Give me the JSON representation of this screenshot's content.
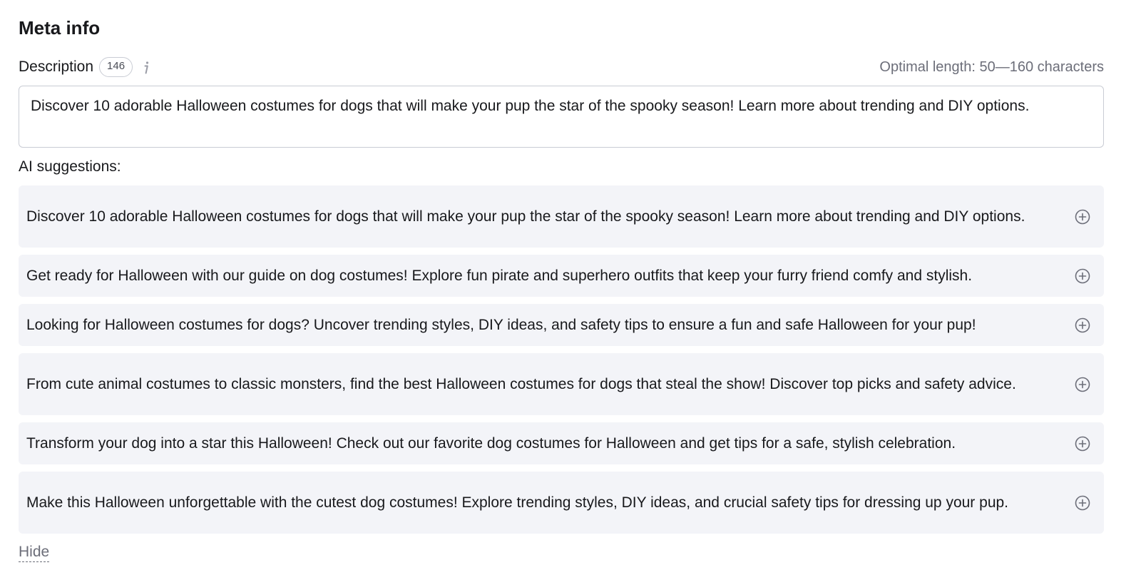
{
  "title": "Meta info",
  "description": {
    "label": "Description",
    "count": "146",
    "optimal_hint": "Optimal length: 50—160 characters",
    "value": "Discover 10 adorable Halloween costumes for dogs that will make your pup the star of the spooky season! Learn more about trending and DIY options."
  },
  "ai": {
    "label": "AI suggestions:",
    "suggestions": [
      {
        "text": "Discover 10 adorable Halloween costumes for dogs that will make your pup the star of the spooky season! Learn more about trending and DIY options."
      },
      {
        "text": "Get ready for Halloween with our guide on dog costumes! Explore fun pirate and superhero outfits that keep your furry friend comfy and stylish."
      },
      {
        "text": "Looking for Halloween costumes for dogs? Uncover trending styles, DIY ideas, and safety tips to ensure a fun and safe Halloween for your pup!"
      },
      {
        "text": "From cute animal costumes to classic monsters, find the best Halloween costumes for dogs that steal the show! Discover top picks and safety advice."
      },
      {
        "text": "Transform your dog into a star this Halloween! Check out our favorite dog costumes for Halloween and get tips for a safe, stylish celebration."
      },
      {
        "text": "Make this Halloween unforgettable with the cutest dog costumes! Explore trending styles, DIY ideas, and crucial safety tips for dressing up your pup."
      }
    ],
    "add_icon": "plus-circle-icon"
  },
  "hide_label": "Hide",
  "info_icon": "info-icon"
}
